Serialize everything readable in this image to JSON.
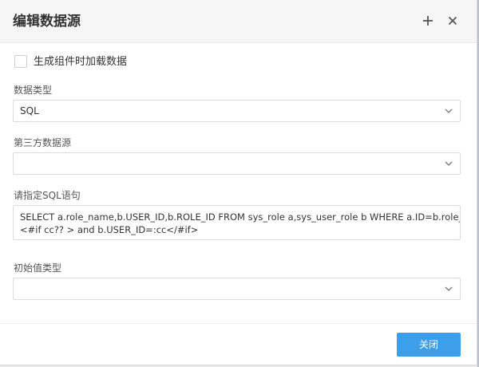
{
  "dialog": {
    "title": "编辑数据源",
    "add_icon": "plus-icon",
    "close_icon": "close-icon"
  },
  "options": {
    "load_on_init_label": "生成组件时加载数据",
    "load_on_init_checked": false
  },
  "fields": {
    "data_type": {
      "label": "数据类型",
      "value": "SQL"
    },
    "third_party_source": {
      "label": "第三方数据源",
      "value": ""
    },
    "sql": {
      "label": "请指定SQL语句",
      "lines": [
        "SELECT a.role_name,b.USER_ID,b.ROLE_ID FROM sys_role a,sys_user_role b WHERE a.ID=b.role_id",
        "<#if cc?? > and b.USER_ID=:cc</#if>"
      ]
    },
    "initial_value_type": {
      "label": "初始值类型",
      "value": ""
    }
  },
  "footer": {
    "close_button_label": "关闭"
  },
  "colors": {
    "primary_button": "#3d9fe9",
    "header_bg": "#f6f6f6"
  }
}
